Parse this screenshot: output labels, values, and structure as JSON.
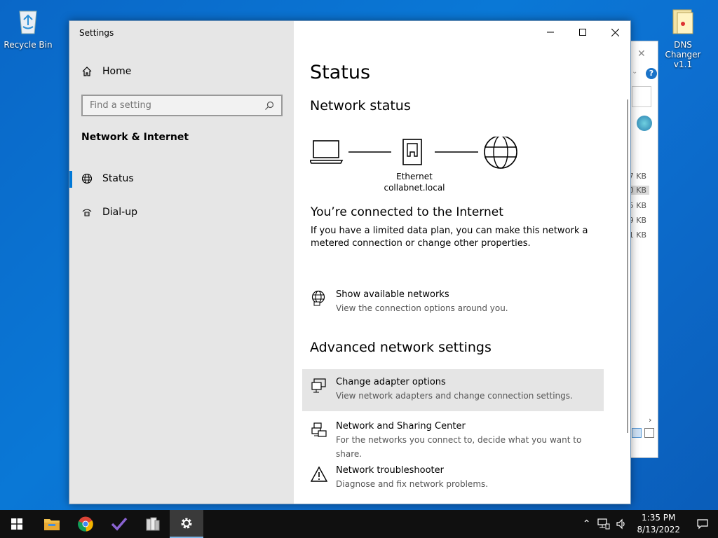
{
  "desktop": {
    "recycle_bin_label": "Recycle Bin",
    "dns_changer_label": "DNS Changer v1.1"
  },
  "background_window": {
    "sizes": [
      "7 KB",
      "0 KB",
      "5 KB",
      "9 KB",
      "1 KB"
    ]
  },
  "window": {
    "title": "Settings",
    "minimize_icon": "minimize-icon",
    "maximize_icon": "maximize-icon",
    "close_icon": "close-icon"
  },
  "sidebar": {
    "home_label": "Home",
    "search_placeholder": "Find a setting",
    "section_title": "Network & Internet",
    "items": [
      {
        "label": "Status",
        "icon": "globe-icon",
        "active": true
      },
      {
        "label": "Dial-up",
        "icon": "dialup-icon",
        "active": false
      }
    ]
  },
  "main": {
    "page_title": "Status",
    "network_status_heading": "Network status",
    "ethernet_label": "Ethernet",
    "domain_label": "collabnet.local",
    "connected_text": "You’re connected to the Internet",
    "connected_desc": "If you have a limited data plan, you can make this network a metered connection or change other properties.",
    "show_networks": {
      "title": "Show available networks",
      "desc": "View the connection options around you."
    },
    "advanced_heading": "Advanced network settings",
    "advanced_items": [
      {
        "title": "Change adapter options",
        "desc": "View network adapters and change connection settings.",
        "icon": "adapter-icon"
      },
      {
        "title": "Network and Sharing Center",
        "desc": "For the networks you connect to, decide what you want to share.",
        "icon": "sharing-center-icon"
      },
      {
        "title": "Network troubleshooter",
        "desc": "Diagnose and fix network problems.",
        "icon": "warning-icon"
      }
    ]
  },
  "taskbar": {
    "time": "1:35 PM",
    "date": "8/13/2022"
  },
  "colors": {
    "accent": "#0078d7",
    "sidebar_bg": "#e6e6e6",
    "desktop_bg": "#0a6fd0"
  }
}
